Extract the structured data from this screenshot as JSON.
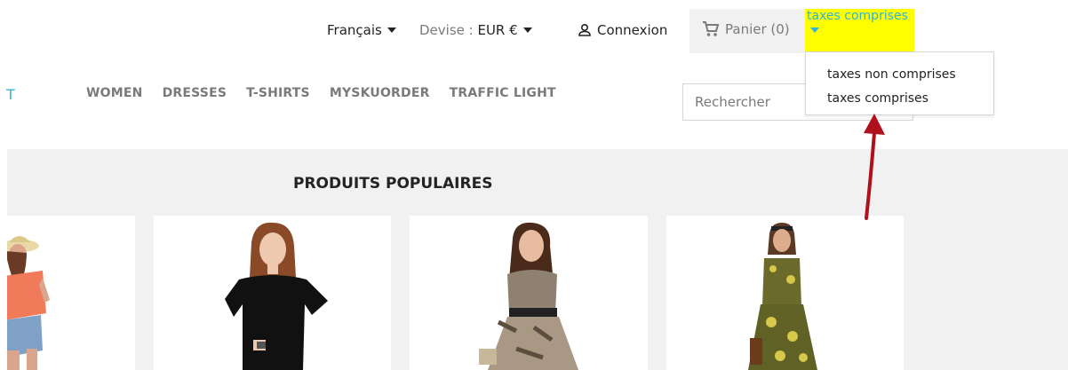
{
  "header": {
    "language": "Français",
    "currency_label": "Devise : ",
    "currency_value": "EUR €",
    "login": "Connexion",
    "cart": "Panier (0)",
    "tax_selected": "taxes comprises"
  },
  "tax_dropdown": {
    "options": [
      "taxes non comprises",
      "taxes comprises"
    ]
  },
  "nav": {
    "logo_fragment": "T",
    "items": [
      "WOMEN",
      "DRESSES",
      "T-SHIRTS",
      "MYSKUORDER",
      "TRAFFIC LIGHT"
    ]
  },
  "search": {
    "placeholder": "Rechercher"
  },
  "main": {
    "section_title": "PRODUITS POPULAIRES"
  },
  "colors": {
    "accent": "#2fb5d2",
    "highlight": "#ffff00",
    "annotation_arrow": "#b0101c"
  }
}
